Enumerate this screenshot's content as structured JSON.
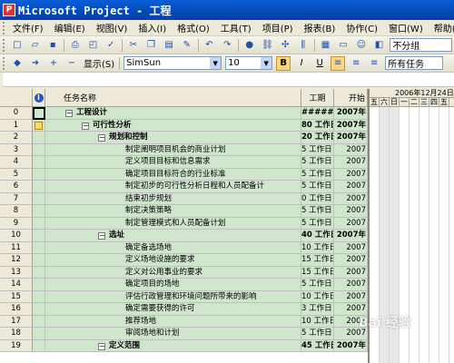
{
  "window": {
    "title": "Microsoft Project - 工程"
  },
  "menu": [
    "文件(F)",
    "编辑(E)",
    "视图(V)",
    "插入(I)",
    "格式(O)",
    "工具(T)",
    "项目(P)",
    "报表(B)",
    "协作(C)",
    "窗口(W)",
    "帮助(H)"
  ],
  "toolbar1": {
    "group_value": "不分组"
  },
  "toolbar2": {
    "show_label": "显示(S)",
    "font": "SimSun",
    "size": "10",
    "bold": "B",
    "italic": "I",
    "underline": "U",
    "filter": "所有任务"
  },
  "columns": {
    "id": "",
    "indicator": "i",
    "name": "任务名称",
    "duration": "工期",
    "start": "开始"
  },
  "gantt": {
    "week_label": "2006年12月24日",
    "days": [
      "五",
      "六",
      "日",
      "一",
      "二",
      "三",
      "四",
      "五"
    ]
  },
  "rows": [
    {
      "id": "0",
      "level": 0,
      "summary": true,
      "name": "工程设计",
      "duration": "########",
      "start": "2007年"
    },
    {
      "id": "1",
      "level": 1,
      "summary": true,
      "name": "可行性分析",
      "duration": "80 工作日",
      "start": "2007年",
      "note": true
    },
    {
      "id": "2",
      "level": 2,
      "summary": true,
      "name": "规划和控制",
      "duration": "20 工作日",
      "start": "2007年"
    },
    {
      "id": "3",
      "level": 3,
      "summary": false,
      "name": "制定阐明项目机会的商业计划",
      "duration": "5 工作日",
      "start": "2007"
    },
    {
      "id": "4",
      "level": 3,
      "summary": false,
      "name": "定义项目目标和信息需求",
      "duration": "5 工作日",
      "start": "2007"
    },
    {
      "id": "5",
      "level": 3,
      "summary": false,
      "name": "确定项目目标符合的行业标准",
      "duration": "5 工作日",
      "start": "2007"
    },
    {
      "id": "6",
      "level": 3,
      "summary": false,
      "name": "制定初步的可行性分析日程和人员配备计",
      "duration": "5 工作日",
      "start": "2007"
    },
    {
      "id": "7",
      "level": 3,
      "summary": false,
      "name": "结束初步规划",
      "duration": "0 工作日",
      "start": "2007"
    },
    {
      "id": "8",
      "level": 3,
      "summary": false,
      "name": "制定决策策略",
      "duration": "5 工作日",
      "start": "2007"
    },
    {
      "id": "9",
      "level": 3,
      "summary": false,
      "name": "制定管理模式和人员配备计划",
      "duration": "5 工作日",
      "start": "2007"
    },
    {
      "id": "10",
      "level": 2,
      "summary": true,
      "name": "选址",
      "duration": "40 工作日",
      "start": "2007年"
    },
    {
      "id": "11",
      "level": 3,
      "summary": false,
      "name": "确定备选场地",
      "duration": "10 工作日",
      "start": "2007"
    },
    {
      "id": "12",
      "level": 3,
      "summary": false,
      "name": "定义场地设施的要求",
      "duration": "15 工作日",
      "start": "2007"
    },
    {
      "id": "13",
      "level": 3,
      "summary": false,
      "name": "定义对公用事业的要求",
      "duration": "15 工作日",
      "start": "2007"
    },
    {
      "id": "14",
      "level": 3,
      "summary": false,
      "name": "确定项目的场地",
      "duration": "5 工作日",
      "start": "2007"
    },
    {
      "id": "15",
      "level": 3,
      "summary": false,
      "name": "评估行政管理和环境问题所带来的影响",
      "duration": "10 工作日",
      "start": "2007"
    },
    {
      "id": "16",
      "level": 3,
      "summary": false,
      "name": "确定需要获得的许可",
      "duration": "3 工作日",
      "start": "2007"
    },
    {
      "id": "17",
      "level": 3,
      "summary": false,
      "name": "推荐场地",
      "duration": "10 工作日",
      "start": "2007"
    },
    {
      "id": "18",
      "level": 3,
      "summary": false,
      "name": "审阅场地和计划",
      "duration": "5 工作日",
      "start": "2007"
    },
    {
      "id": "19",
      "level": 2,
      "summary": true,
      "name": "定义范围",
      "duration": "45 工作日",
      "start": "2007年"
    }
  ],
  "watermark": "Bai 经验"
}
